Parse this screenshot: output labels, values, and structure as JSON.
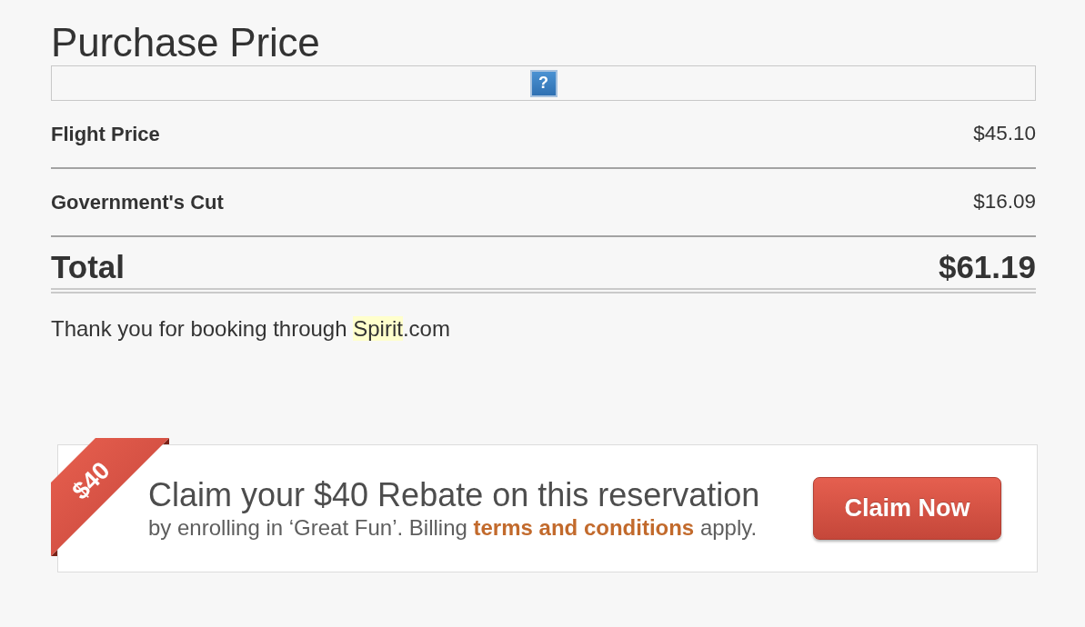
{
  "title": "Purchase Price",
  "help_button": {
    "label": "?"
  },
  "line_items": [
    {
      "kind": "item",
      "label": "Flight Price",
      "amount": "$45.10"
    },
    {
      "kind": "item",
      "label": "Government's Cut",
      "amount": "$16.09"
    },
    {
      "kind": "total",
      "label": "Total",
      "amount": "$61.19"
    }
  ],
  "thank_you": {
    "text": "Thank you for booking through ",
    "highlight": "Spirit",
    "suffix": ".com"
  },
  "rebate_offer": {
    "ribbon": "$40",
    "headline": "Claim your $40 Rebate on this reservation",
    "details": {
      "text": "by enrolling in ‘Great Fun’. Billing ",
      "link": "terms and conditions",
      "suffix": " apply."
    },
    "button": "Claim Now"
  }
}
